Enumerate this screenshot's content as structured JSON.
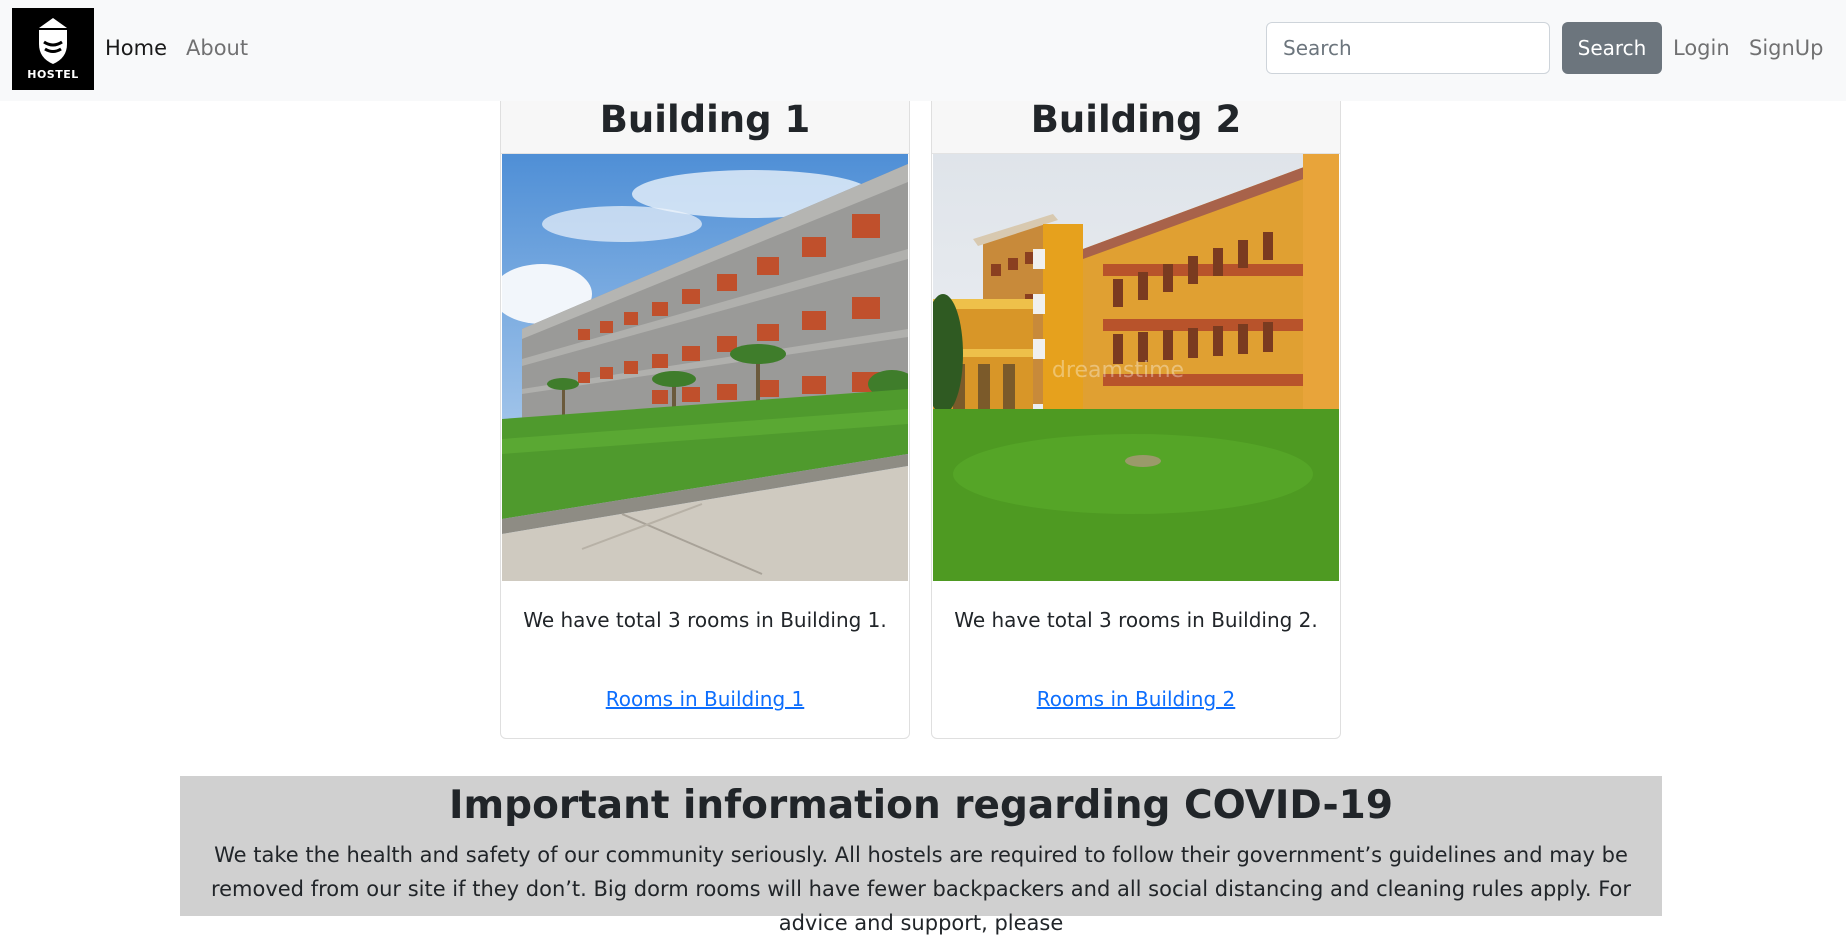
{
  "navbar": {
    "logo_text": "HOSTEL",
    "links": [
      {
        "label": "Home",
        "active": true
      },
      {
        "label": "About",
        "active": false
      }
    ],
    "search": {
      "placeholder": "Search",
      "value": "",
      "button_label": "Search"
    },
    "auth": {
      "login_label": "Login",
      "signup_label": "SignUp"
    }
  },
  "buildings": [
    {
      "title": "Building 1",
      "description": "We have total 3 rooms in Building 1.",
      "link_label": "Rooms in Building 1"
    },
    {
      "title": "Building 2",
      "description": "We have total 3 rooms in Building 2.",
      "link_label": "Rooms in Building 2",
      "image_watermark": "dreamstime"
    }
  ],
  "covid": {
    "title": "Important information regarding COVID-19",
    "text": "We take the health and safety of our community seriously. All hostels are required to follow their government’s guidelines and may be removed from our site if they don’t. Big dorm rooms will have fewer backpackers and all social distancing and cleaning rules apply. For advice and support, please"
  },
  "colors": {
    "navbar_bg": "#f8f9fa",
    "search_button": "#6c757d",
    "link": "#0d6efd",
    "covid_bg": "#d0d0d0"
  }
}
